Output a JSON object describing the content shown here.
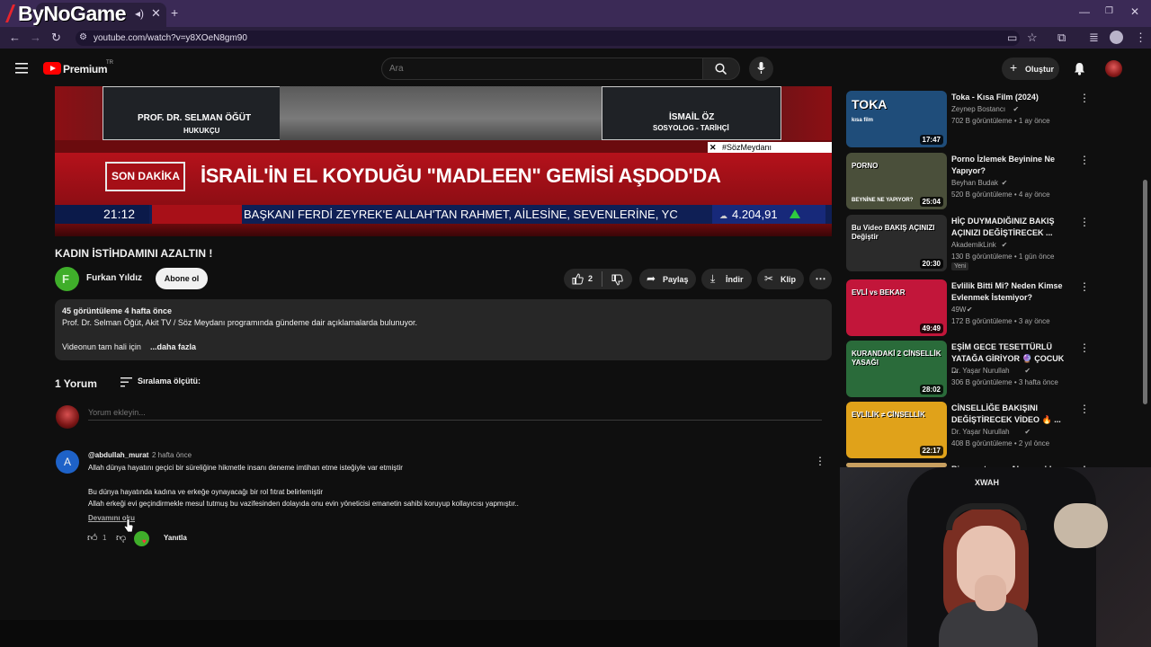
{
  "browser": {
    "overlay_logo": "ByNoGame",
    "url": "youtube.com/watch?v=y8XOeN8gm90"
  },
  "youtube": {
    "brand": "Premium",
    "region": "TR",
    "search_placeholder": "Ara",
    "create_label": "Oluştur"
  },
  "video": {
    "guest_left": "PROF. DR. SELMAN ÖĞÜT",
    "guest_left_role": "HUKUKÇU",
    "guest_right": "İSMAİL ÖZ",
    "guest_right_role": "SOSYOLOG - TARİHÇİ",
    "hashtag": "#SözMeydanı",
    "breaking": "SON DAKİKA",
    "headline": "İSRAİL'İN EL KOYDUĞU \"MADLEEN\" GEMİSİ AŞDOD'DA",
    "time": "21:12",
    "ticker": "BAŞKANI FERDİ ZEYREK'E ALLAH'TAN RAHMET, AİLESİNE, SEVENLERİNE, YC",
    "index_value": "4.204,91"
  },
  "info": {
    "title": "KADIN İSTİHDAMINI AZALTIN !",
    "channel": "Furkan Yıldız",
    "subscribe": "Abone ol",
    "likes": "2",
    "share": "Paylaş",
    "download": "İndir",
    "clip": "Klip"
  },
  "description": {
    "stats": "45 görüntüleme  4 hafta önce",
    "line1": "Prof. Dr. Selman Öğüt, Akit TV / Söz Meydanı programında gündeme dair açıklamalarda bulunuyor.",
    "line2": "Videonun tam hali için",
    "more": "...daha fazla"
  },
  "comments": {
    "count": "1 Yorum",
    "sort": "Sıralama ölçütü:",
    "add_placeholder": "Yorum ekleyin...",
    "items": [
      {
        "avatar_letter": "A",
        "author": "@abdullah_murat",
        "time": "2 hafta önce",
        "line1": "Allah dünya hayatını geçici bir süreliğine hikmetle insanı deneme imtihan etme isteğiyle var etmiştir",
        "line2": "Bu dünya hayatında kadına ve erkeğe oynayacağı bir rol fıtrat belirlemiştir",
        "line3": "Allah erkeği evi geçindirmekle mesul tutmuş bu vazifesinden dolayıda onu  evin yöneticisi emanetin sahibi koruyup kollayıcısı yapmıştır..",
        "read_more": "Devamını oku",
        "likes": "1",
        "reply": "Yanıtla"
      }
    ]
  },
  "recommendations": [
    {
      "title": "Toka - Kısa Film (2024)",
      "channel": "Zeynep Bostancı",
      "meta": "702 B görüntüleme • 1 ay önce",
      "duration": "17:47",
      "thumb_text": "TOKA",
      "thumb_sub": "kısa film",
      "color": "#1f4d7a"
    },
    {
      "title": "Porno İzlemek Beyinine Ne Yapıyor?",
      "channel": "Beyhan Budak",
      "meta": "520 B görüntüleme • 4 ay önce",
      "duration": "25:04",
      "thumb_text": "PORNO",
      "thumb_sub": "BEYNİNE NE YAPIYOR?",
      "color": "#4a4f3a"
    },
    {
      "title": "HİÇ DUYMADIĞINIZ BAKIŞ AÇINIZI DEĞİŞTİRECEK ...",
      "channel": "AkademikLink",
      "meta": "130 B görüntüleme • 1 gün önce",
      "badge": "Yeni",
      "duration": "20:30",
      "thumb_text": "Bu Video BAKIŞ AÇINIZI Değiştir",
      "color": "#2b2b2b"
    },
    {
      "title": "Evlilik Bitti Mi? Neden Kimse Evlenmek İstemiyor?",
      "channel": "49W",
      "meta": "172 B görüntüleme • 3 ay önce",
      "duration": "49:49",
      "thumb_text": "EVLİ vs BEKAR",
      "color": "#c2163a"
    },
    {
      "title": "EŞİM GECE TESETTÜRLÜ YATAĞA GİRİYOR 🔮 ÇOCUK ...",
      "channel": "Dr. Yaşar Nurullah",
      "meta": "306 B görüntüleme • 3 hafta önce",
      "duration": "28:02",
      "thumb_text": "KURANDAKİ 2 CİNSELLİK YASAĞI",
      "color": "#2a6b3a"
    },
    {
      "title": "CİNSELLİĞE BAKIŞINI DEĞİŞTİRECEK VİDEO 🔥 ...",
      "channel": "Dr. Yaşar Nurullah",
      "meta": "408 B görüntüleme • 2 yıl önce",
      "duration": "22:17",
      "thumb_text": "EVLİLİK ≠ CİNSELLİK",
      "color": "#e0a21a"
    },
    {
      "title": "Bir uyuşturucu Almanya'da bir",
      "channel": "",
      "meta": "",
      "duration": "",
      "thumb_text": "",
      "color": "#c8a060"
    }
  ]
}
